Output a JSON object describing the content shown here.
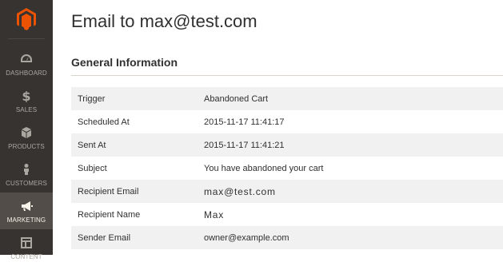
{
  "nav": [
    {
      "label": "DASHBOARD",
      "icon": "dashboard-icon"
    },
    {
      "label": "SALES",
      "icon": "dollar-icon"
    },
    {
      "label": "PRODUCTS",
      "icon": "box-icon"
    },
    {
      "label": "CUSTOMERS",
      "icon": "person-icon"
    },
    {
      "label": "MARKETING",
      "icon": "megaphone-icon",
      "active": true
    },
    {
      "label": "CONTENT",
      "icon": "layout-icon"
    }
  ],
  "page": {
    "title": "Email to max@test.com"
  },
  "section": {
    "title": "General Information"
  },
  "rows": [
    {
      "label": "Trigger",
      "value": "Abandoned Cart"
    },
    {
      "label": "Scheduled At",
      "value": "2015-11-17 11:41:17"
    },
    {
      "label": "Sent At",
      "value": "2015-11-17 11:41:21"
    },
    {
      "label": "Subject",
      "value": "You have abandoned your cart"
    },
    {
      "label": "Recipient Email",
      "value": "max@test.com"
    },
    {
      "label": "Recipient Name",
      "value": "Max"
    },
    {
      "label": "Sender Email",
      "value": "owner@example.com"
    }
  ],
  "colors": {
    "sidebar_bg": "#373330",
    "sidebar_active_bg": "#524d49",
    "logo_orange": "#eb5202",
    "row_stripe": "#f1f1f1"
  }
}
